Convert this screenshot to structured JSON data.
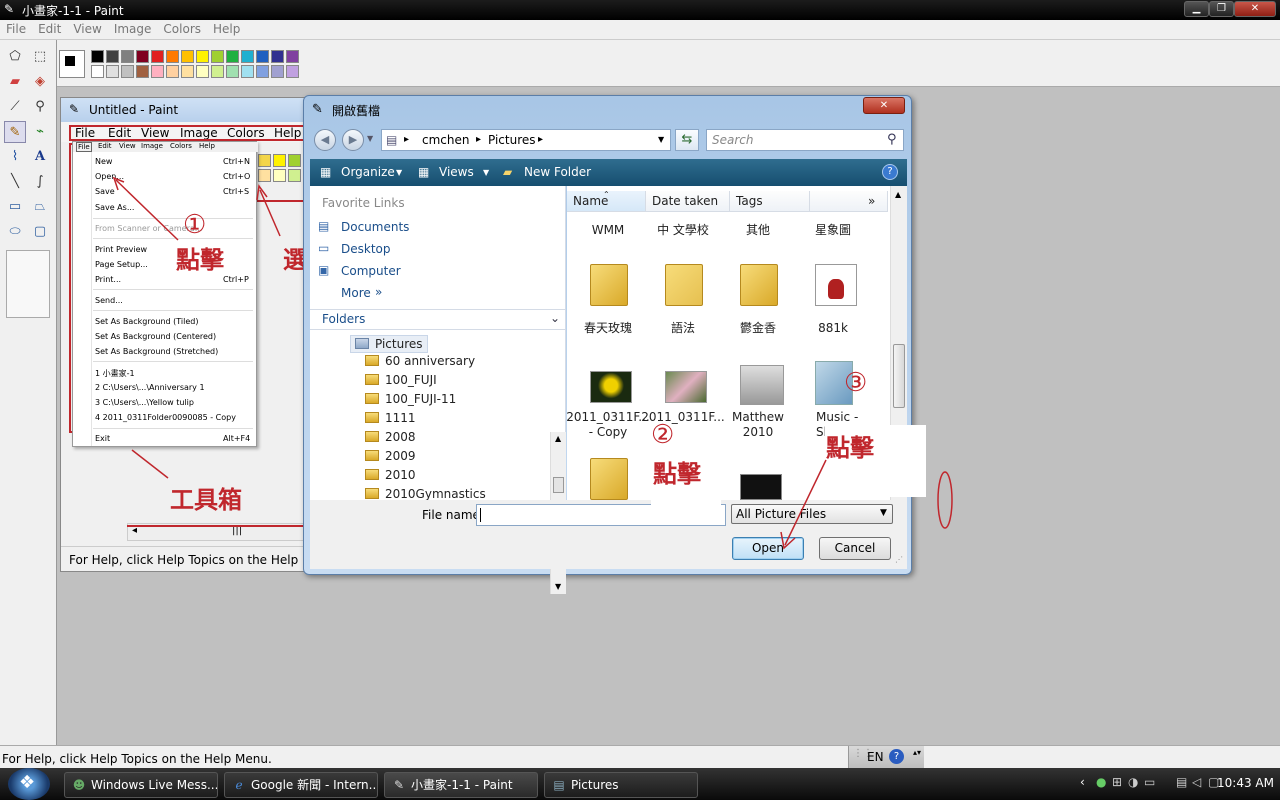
{
  "window": {
    "title": "小畫家-1-1 - Paint"
  },
  "menu": [
    "File",
    "Edit",
    "View",
    "Image",
    "Colors",
    "Help"
  ],
  "palette": {
    "row1": [
      "#000000",
      "#404040",
      "#808080",
      "#800020",
      "#e02020",
      "#ff7a00",
      "#ffc000",
      "#fff200",
      "#a0d030",
      "#20b040",
      "#20b0d0",
      "#2060c0",
      "#303090",
      "#8040a0"
    ],
    "row2": [
      "#ffffff",
      "#e0e0e0",
      "#c0c0c0",
      "#a06040",
      "#ffb0c0",
      "#ffd0a0",
      "#ffe0a0",
      "#ffffc0",
      "#d0f090",
      "#a0e0b0",
      "#a0e0f0",
      "#80a0e0",
      "#a0a0d0",
      "#c0a0e0"
    ]
  },
  "status": {
    "text": "For Help, click Help Topics on the Help Menu.",
    "lang": "EN"
  },
  "inner_paint": {
    "title": "Untitled - Paint",
    "menu": [
      "File",
      "Edit",
      "View",
      "Image",
      "Colors",
      "Help"
    ],
    "file_menu_bar": [
      "File",
      "Edit",
      "View",
      "Image",
      "Colors",
      "Help"
    ],
    "status": "For Help, click Help Topics on the Help Menu",
    "file_menu": [
      {
        "label": "New",
        "shortcut": "Ctrl+N"
      },
      {
        "label": "Open...",
        "shortcut": "Ctrl+O"
      },
      {
        "label": "Save",
        "shortcut": "Ctrl+S"
      },
      {
        "label": "Save As...",
        "shortcut": ""
      },
      {
        "label": "From Scanner or Camera...",
        "shortcut": ""
      },
      {
        "label": "Print Preview",
        "shortcut": ""
      },
      {
        "label": "Page Setup...",
        "shortcut": ""
      },
      {
        "label": "Print...",
        "shortcut": "Ctrl+P"
      },
      {
        "label": "Send...",
        "shortcut": ""
      },
      {
        "label": "Set As Background (Tiled)",
        "shortcut": ""
      },
      {
        "label": "Set As Background (Centered)",
        "shortcut": ""
      },
      {
        "label": "Set As Background (Stretched)",
        "shortcut": ""
      },
      {
        "label": "1 小畫家-1",
        "shortcut": ""
      },
      {
        "label": "2 C:\\Users\\...\\Anniversary 1",
        "shortcut": ""
      },
      {
        "label": "3 C:\\Users\\...\\Yellow tulip",
        "shortcut": ""
      },
      {
        "label": "4 2011_0311Folder0090085 - Copy",
        "shortcut": ""
      },
      {
        "label": "Exit",
        "shortcut": "Alt+F4"
      }
    ]
  },
  "annotations": {
    "click1": "①",
    "click_label": "點擊",
    "select_partial": "選",
    "toolbox": "工具箱",
    "circle2": "②",
    "circle3": "③"
  },
  "dialog": {
    "title": "開啟舊檔",
    "breadcrumb": [
      "cmchen",
      "Pictures"
    ],
    "search_placeholder": "Search",
    "toolbar": {
      "organize": "Organize",
      "views": "Views",
      "new_folder": "New Folder"
    },
    "favorite_links_header": "Favorite Links",
    "favorite_links": [
      "Documents",
      "Desktop",
      "Computer"
    ],
    "more": "More",
    "folders_header": "Folders",
    "tree": [
      "Pictures",
      "60 anniversary",
      "100_FUJI",
      "100_FUJI-11",
      "1111",
      "2008",
      "2009",
      "2010",
      "2010Gymnastics"
    ],
    "columns": [
      "Name",
      "Date taken",
      "Tags"
    ],
    "top_labels": [
      "WMM",
      "中 文學校",
      "其他",
      "星象圖"
    ],
    "row1": [
      "春天玫瑰",
      "語法",
      "鬱金香",
      "881k"
    ],
    "row2": [
      [
        "2011_0311F...",
        "- Copy"
      ],
      [
        "2011_0311F...",
        ""
      ],
      [
        "Matthew",
        "2010"
      ],
      [
        "Music -",
        "Sh"
      ]
    ],
    "file_name_label": "File name:",
    "file_name_value": "",
    "filter": "All Picture Files",
    "open": "Open",
    "cancel": "Cancel"
  },
  "taskbar": {
    "items": [
      "Windows Live Mess...",
      "Google 新聞 - Intern...",
      "小畫家-1-1 - Paint",
      "Pictures"
    ],
    "time": "10:43 AM"
  }
}
